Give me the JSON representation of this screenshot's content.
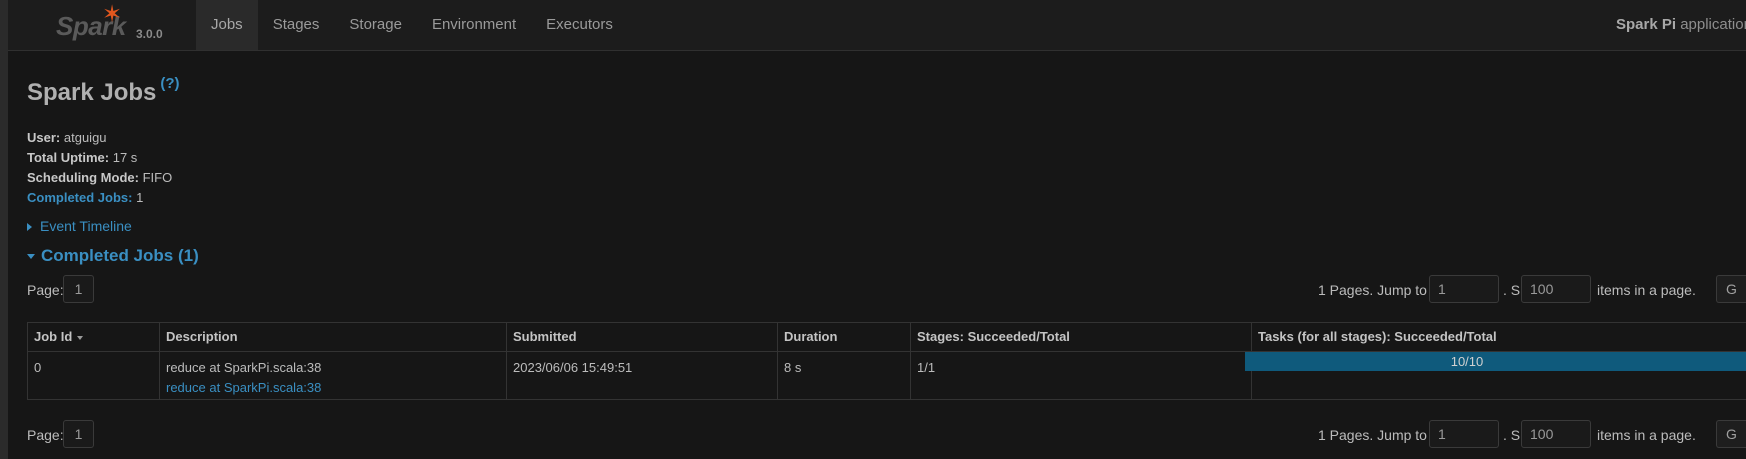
{
  "brand": {
    "name": "Spark",
    "version": "3.0.0"
  },
  "nav": {
    "tabs": [
      "Jobs",
      "Stages",
      "Storage",
      "Environment",
      "Executors"
    ],
    "active": "Jobs"
  },
  "app": {
    "name": "Spark Pi",
    "suffix": " application"
  },
  "page": {
    "title": "Spark Jobs",
    "help": "(?)"
  },
  "summary": {
    "user_label": "User:",
    "user": "atguigu",
    "uptime_label": "Total Uptime:",
    "uptime": "17 s",
    "mode_label": "Scheduling Mode:",
    "mode": "FIFO",
    "completed_label": "Completed Jobs:",
    "completed": "1"
  },
  "event_timeline": "Event Timeline",
  "completed_section": "Completed Jobs (1)",
  "pagination": {
    "page_label": "Page:",
    "page": "1",
    "pages_text": "1 Pages. Jump to",
    "jump_value": "1",
    "show_text": ". Show",
    "show_value": "100",
    "items_text": "items in a page.",
    "go_label": "G"
  },
  "table": {
    "headers": [
      "Job Id",
      "Description",
      "Submitted",
      "Duration",
      "Stages: Succeeded/Total",
      "Tasks (for all stages): Succeeded/Total"
    ],
    "rows": [
      {
        "job_id": "0",
        "description": "reduce at SparkPi.scala:38",
        "description_link": "reduce at SparkPi.scala:38",
        "submitted": "2023/06/06 15:49:51",
        "duration": "8 s",
        "stages": "1/1",
        "tasks": "10/10",
        "tasks_fraction": 1.0
      }
    ]
  },
  "colors": {
    "accent": "#3a8fc2",
    "brand_star": "#e2571e",
    "progress": "#0f5a7c"
  }
}
